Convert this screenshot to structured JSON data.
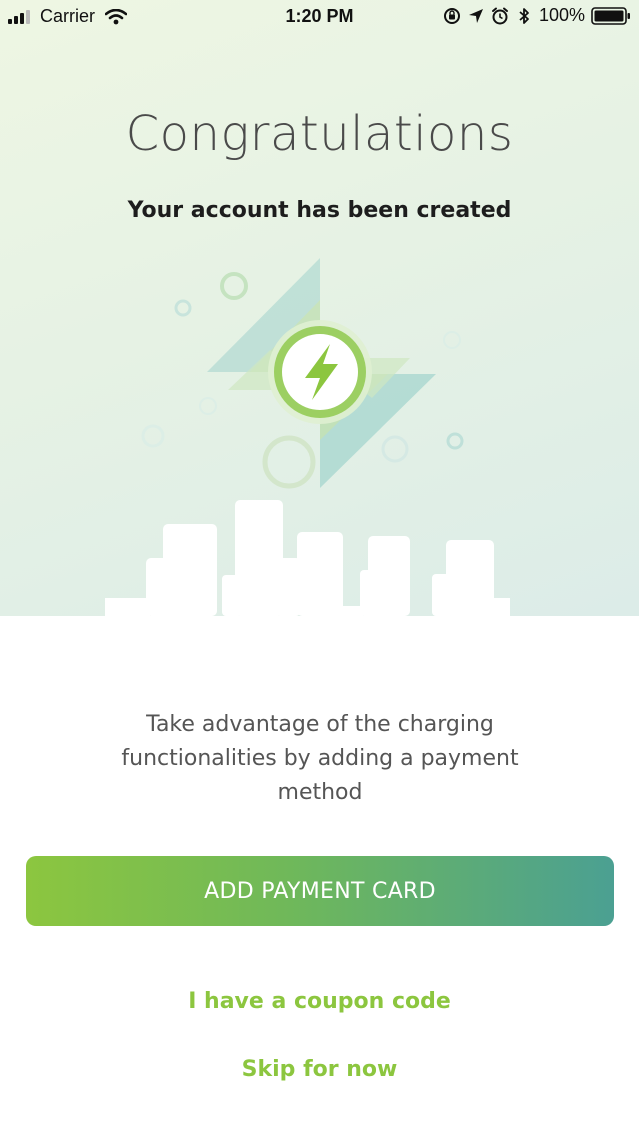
{
  "status_bar": {
    "carrier": "Carrier",
    "time": "1:20 PM",
    "battery": "100%",
    "icons": [
      "signal-icon",
      "wifi-icon",
      "orientation-lock-icon",
      "location-icon",
      "alarm-icon",
      "bluetooth-icon",
      "battery-icon"
    ]
  },
  "hero": {
    "title": "Congratulations",
    "subtitle": "Your account has been created",
    "illustration_icon": "lightning-bolt-icon"
  },
  "content": {
    "message": "Take advantage of the charging functionalities by adding a payment method",
    "primary_button": "ADD PAYMENT CARD",
    "coupon_link": "I have a coupon code",
    "skip_link": "Skip for now"
  },
  "colors": {
    "accent_green": "#8cc63f",
    "accent_teal": "#4ba092",
    "title_gray": "#4a4a4a",
    "body_gray": "#555555"
  }
}
